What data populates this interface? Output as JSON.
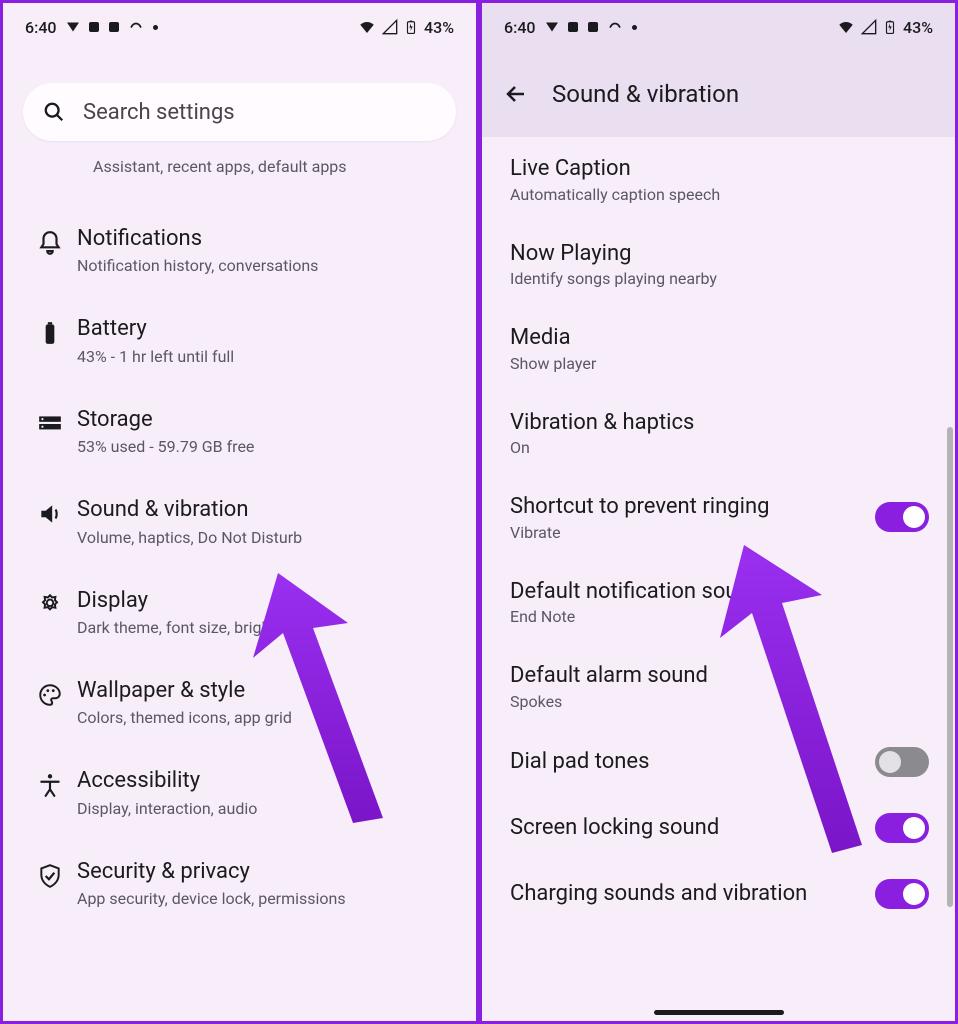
{
  "status": {
    "time": "6:40",
    "battery": "43%"
  },
  "left": {
    "search_placeholder": "Search settings",
    "cutoff_sub": "Assistant, recent apps, default apps",
    "items": [
      {
        "title": "Notifications",
        "sub": "Notification history, conversations"
      },
      {
        "title": "Battery",
        "sub": "43% - 1 hr left until full"
      },
      {
        "title": "Storage",
        "sub": "53% used - 59.79 GB free"
      },
      {
        "title": "Sound & vibration",
        "sub": "Volume, haptics, Do Not Disturb"
      },
      {
        "title": "Display",
        "sub": "Dark theme, font size, brightness"
      },
      {
        "title": "Wallpaper & style",
        "sub": "Colors, themed icons, app grid"
      },
      {
        "title": "Accessibility",
        "sub": "Display, interaction, audio"
      },
      {
        "title": "Security & privacy",
        "sub": "App security, device lock, permissions"
      }
    ]
  },
  "right": {
    "page_title": "Sound & vibration",
    "items": [
      {
        "title": "Live Caption",
        "sub": "Automatically caption speech",
        "switch": null
      },
      {
        "title": "Now Playing",
        "sub": "Identify songs playing nearby",
        "switch": null
      },
      {
        "title": "Media",
        "sub": "Show player",
        "switch": null
      },
      {
        "title": "Vibration & haptics",
        "sub": "On",
        "switch": null
      },
      {
        "title": "Shortcut to prevent ringing",
        "sub": "Vibrate",
        "switch": true
      },
      {
        "title": "Default notification sound",
        "sub": "End Note",
        "switch": null
      },
      {
        "title": "Default alarm sound",
        "sub": "Spokes",
        "switch": null
      },
      {
        "title": "Dial pad tones",
        "sub": null,
        "switch": false
      },
      {
        "title": "Screen locking sound",
        "sub": null,
        "switch": true
      },
      {
        "title": "Charging sounds and vibration",
        "sub": null,
        "switch": true
      }
    ]
  }
}
